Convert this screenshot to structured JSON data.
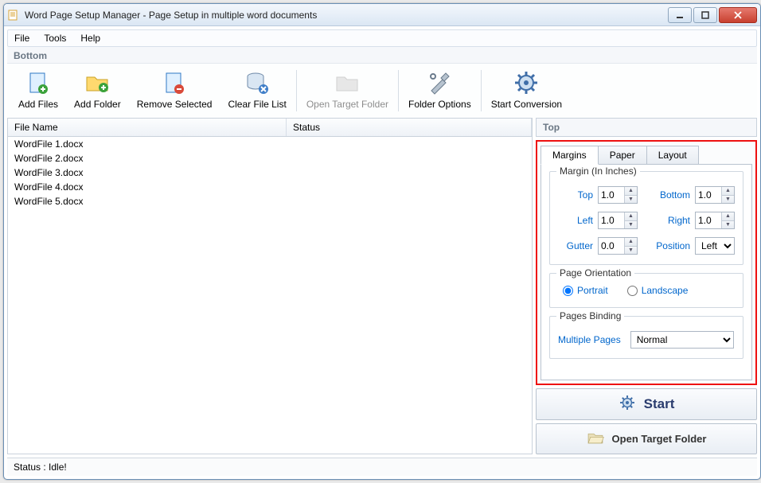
{
  "window": {
    "title": "Word Page Setup Manager - Page Setup in multiple word documents"
  },
  "menu": {
    "file": "File",
    "tools": "Tools",
    "help": "Help"
  },
  "section_bottom": "Bottom",
  "toolbar": {
    "add_files": "Add Files",
    "add_folder": "Add Folder",
    "remove_selected": "Remove Selected",
    "clear_file_list": "Clear File List",
    "open_target_folder": "Open Target Folder",
    "folder_options": "Folder Options",
    "start_conversion": "Start Conversion"
  },
  "columns": {
    "file_name": "File Name",
    "status": "Status"
  },
  "files": [
    {
      "name": "WordFile 1.docx"
    },
    {
      "name": "WordFile 2.docx"
    },
    {
      "name": "WordFile 3.docx"
    },
    {
      "name": "WordFile 4.docx"
    },
    {
      "name": "WordFile 5.docx"
    }
  ],
  "right": {
    "top_label": "Top",
    "tabs": {
      "margins": "Margins",
      "paper": "Paper",
      "layout": "Layout"
    },
    "margins": {
      "legend": "Margin (In Inches)",
      "top_label": "Top",
      "top_value": "1.0",
      "bottom_label": "Bottom",
      "bottom_value": "1.0",
      "left_label": "Left",
      "left_value": "1.0",
      "right_label": "Right",
      "right_value": "1.0",
      "gutter_label": "Gutter",
      "gutter_value": "0.0",
      "position_label": "Position",
      "position_value": "Left"
    },
    "orientation": {
      "legend": "Page Orientation",
      "portrait": "Portrait",
      "landscape": "Landscape",
      "selected": "portrait"
    },
    "binding": {
      "legend": "Pages Binding",
      "multiple_pages_label": "Multiple Pages",
      "multiple_pages_value": "Normal"
    },
    "start_button": "Start",
    "open_target_button": "Open Target Folder"
  },
  "status": {
    "text": "Status  :  Idle!"
  }
}
